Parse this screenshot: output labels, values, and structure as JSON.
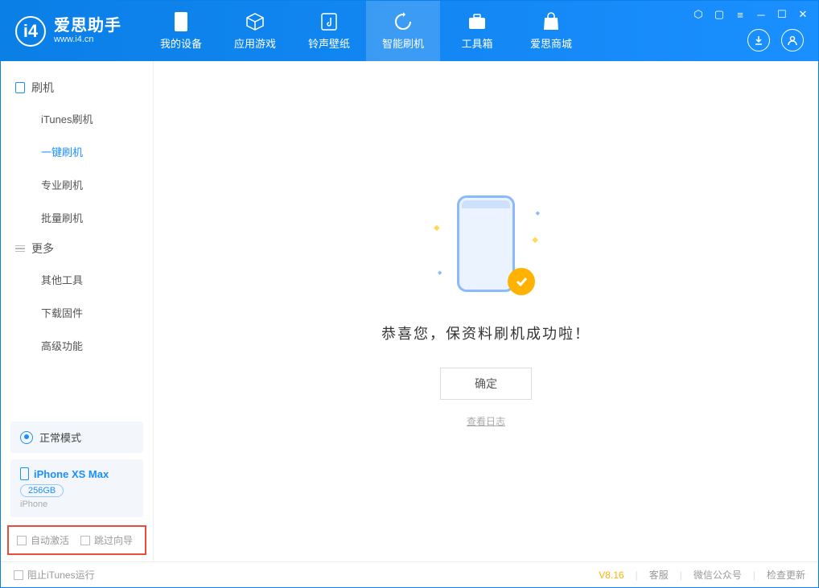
{
  "app": {
    "title": "爱思助手",
    "subtitle": "www.i4.cn"
  },
  "nav": {
    "tabs": [
      {
        "label": "我的设备"
      },
      {
        "label": "应用游戏"
      },
      {
        "label": "铃声壁纸"
      },
      {
        "label": "智能刷机"
      },
      {
        "label": "工具箱"
      },
      {
        "label": "爱思商城"
      }
    ]
  },
  "sidebar": {
    "group1_title": "刷机",
    "group1": [
      {
        "label": "iTunes刷机"
      },
      {
        "label": "一键刷机"
      },
      {
        "label": "专业刷机"
      },
      {
        "label": "批量刷机"
      }
    ],
    "group2_title": "更多",
    "group2": [
      {
        "label": "其他工具"
      },
      {
        "label": "下载固件"
      },
      {
        "label": "高级功能"
      }
    ],
    "mode_label": "正常模式",
    "device": {
      "name": "iPhone XS Max",
      "capacity": "256GB",
      "type": "iPhone"
    },
    "checkboxes": {
      "auto_activate": "自动激活",
      "skip_guide": "跳过向导"
    }
  },
  "main": {
    "success_message": "恭喜您，保资料刷机成功啦！",
    "ok_button": "确定",
    "view_log": "查看日志"
  },
  "footer": {
    "block_itunes": "阻止iTunes运行",
    "version": "V8.16",
    "links": {
      "service": "客服",
      "wechat": "微信公众号",
      "update": "检查更新"
    }
  }
}
